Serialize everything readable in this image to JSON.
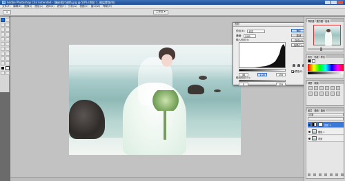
{
  "window": {
    "title": "Adobe Photoshop CS3 Extended - [婚纱照片调色.jpg @ 50% (色阶 1, 图层蒙版/8)]"
  },
  "menubar": {
    "items": [
      "文件(F)",
      "编辑(E)",
      "图像(I)",
      "图层(L)",
      "选择(S)",
      "滤镜(T)",
      "分析(A)",
      "视图(V)",
      "窗口(W)",
      "帮助(H)"
    ]
  },
  "optionsbar": {
    "workspace_label": "工作区 ▾"
  },
  "levels_dialog": {
    "title": "色阶",
    "preset_label": "预设(E):",
    "preset_value": "自定",
    "channel_label": "通道:",
    "channel_value": "RGB",
    "input_label": "输入色阶(I):",
    "output_label": "输出色阶(O):",
    "input_black": "46",
    "input_gamma": "1.00",
    "input_white": "255",
    "output_black": "0",
    "output_white": "255",
    "buttons": {
      "ok": "确定",
      "cancel": "取消",
      "auto": "自动(A)",
      "options": "选项(T)..."
    },
    "preview_label": "预览(P)"
  },
  "right_panels": {
    "navigator_tabs": [
      "导航器",
      "直方图",
      "信息"
    ],
    "color_tabs": [
      "颜色",
      "色板",
      "样式"
    ],
    "adjust_tabs": [
      "调整",
      "蒙版"
    ],
    "layers_tabs": [
      "图层",
      "通道",
      "路径"
    ],
    "blend_mode": "正常",
    "layers": [
      {
        "name": "色阶 1"
      },
      {
        "name": "图层 1"
      },
      {
        "name": "背景"
      }
    ]
  },
  "colors": {
    "titlebar": "#2a5ea9",
    "selected_layer": "#3b78d8",
    "canvas_bg": "#c2c2c2"
  }
}
